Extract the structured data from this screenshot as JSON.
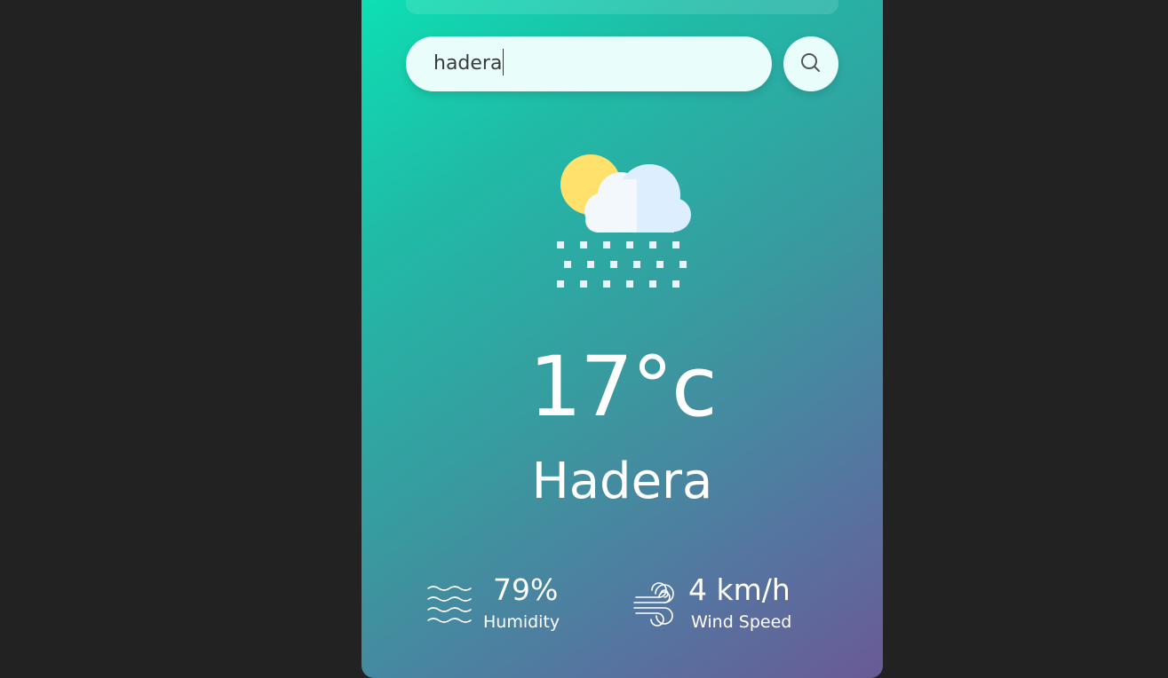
{
  "search": {
    "value": "hadera"
  },
  "weather": {
    "icon": "snow-cloud-sun-icon",
    "temperature": "17°c",
    "city": "Hadera"
  },
  "details": {
    "humidity": {
      "icon": "humidity-waves-icon",
      "value": "79%",
      "label": "Humidity"
    },
    "wind": {
      "icon": "wind-icon",
      "value": "4 km/h",
      "label": "Wind Speed"
    }
  },
  "colors": {
    "background": "#222222",
    "gradient_start": "#0be3b4",
    "gradient_end": "#6a5a95",
    "input_background": "#e9fefa",
    "sun": "#ffe16b",
    "cloud": "#f2f8fc"
  }
}
